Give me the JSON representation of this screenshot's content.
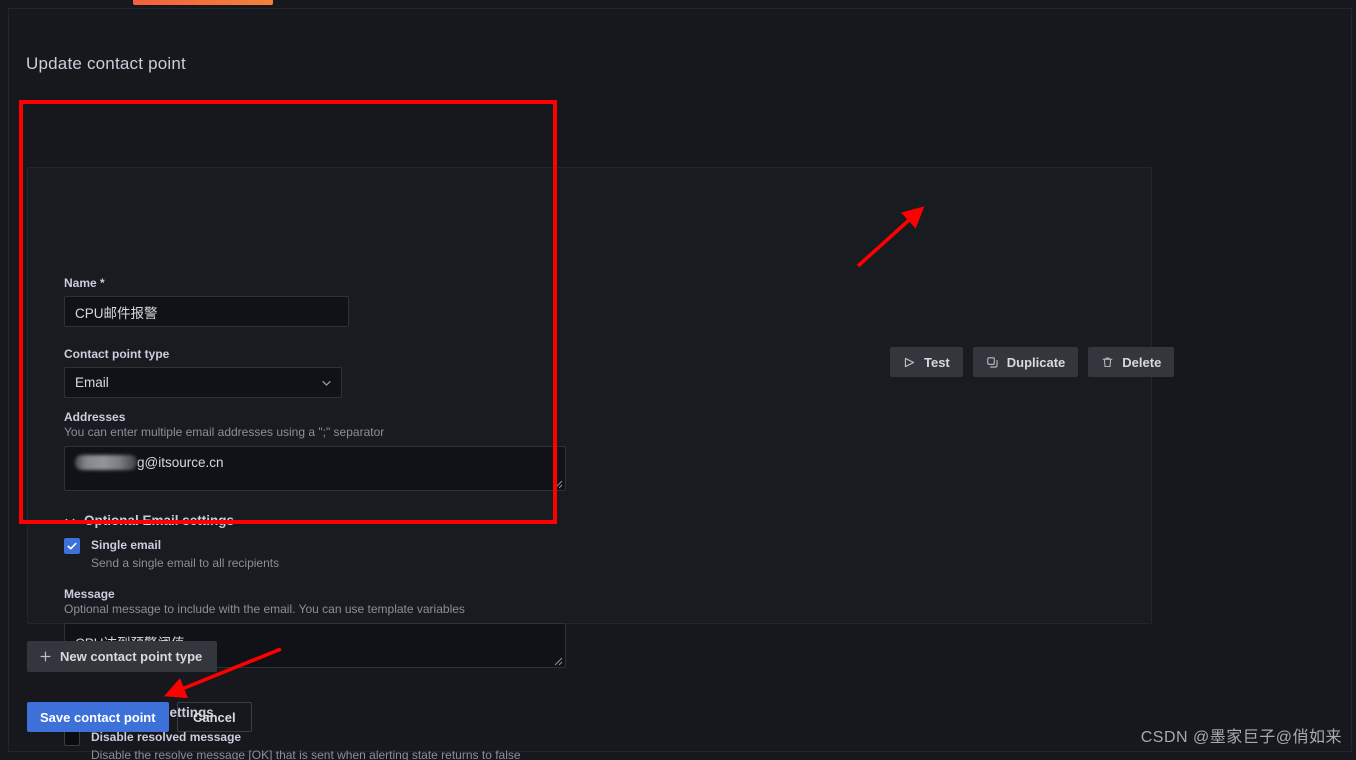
{
  "page": {
    "title": "Update contact point",
    "watermark": "CSDN @墨家巨子@俏如来",
    "accent_orange": "#f55f3e",
    "annotation_red": "#fe0000",
    "primary_blue": "#3d71d9",
    "card_bg": "#181b1f",
    "page_bg": "#16181d"
  },
  "form": {
    "name": {
      "label": "Name *",
      "value": "CPU邮件报警",
      "placeholder": "Name"
    },
    "contact_point_type": {
      "label": "Contact point type",
      "value": "Email",
      "options": [
        "Email"
      ]
    },
    "addresses": {
      "label": "Addresses",
      "description": "You can enter multiple email addresses using a \";\" separator",
      "value_redacted_prefix": true,
      "value_suffix": "g@itsource.cn"
    },
    "optional_email_settings": {
      "label": "Optional Email settings",
      "expanded": true,
      "single_email": {
        "label": "Single email",
        "description": "Send a single email to all recipients",
        "checked": true
      },
      "message": {
        "label": "Message",
        "description": "Optional message to include with the email. You can use template variables",
        "value": "CPU达到预警阈值"
      }
    },
    "notification_settings": {
      "label": "Notification settings",
      "expanded": true,
      "disable_resolved_message": {
        "label": "Disable resolved message",
        "description": "Disable the resolve message [OK] that is sent when alerting state returns to false",
        "checked": false
      }
    }
  },
  "actions": {
    "test": {
      "label": "Test",
      "icon": "send-icon"
    },
    "duplicate": {
      "label": "Duplicate",
      "icon": "copy-icon"
    },
    "delete": {
      "label": "Delete",
      "icon": "trash-icon"
    },
    "new_contact_point_type": {
      "label": "New contact point type",
      "icon": "plus-icon"
    },
    "save": {
      "label": "Save contact point"
    },
    "cancel": {
      "label": "Cancel"
    }
  }
}
